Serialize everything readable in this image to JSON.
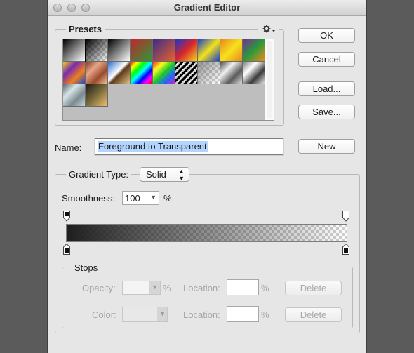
{
  "window": {
    "title": "Gradient Editor"
  },
  "presets": {
    "label": "Presets",
    "menu_icon": "gear-icon",
    "swatches": [
      {
        "name": "foreground-to-background"
      },
      {
        "name": "foreground-to-transparent"
      },
      {
        "name": "black-white"
      },
      {
        "name": "red-green"
      },
      {
        "name": "violet-orange"
      },
      {
        "name": "blue-red-yellow"
      },
      {
        "name": "blue-yellow-blue"
      },
      {
        "name": "orange-yellow-orange"
      },
      {
        "name": "violet-green-orange"
      },
      {
        "name": "yellow-violet-orange-blue"
      },
      {
        "name": "copper"
      },
      {
        "name": "chrome"
      },
      {
        "name": "spectrum"
      },
      {
        "name": "transparent-rainbow"
      },
      {
        "name": "transparent-stripes"
      },
      {
        "name": "neutral-density"
      },
      {
        "name": "silver-1"
      },
      {
        "name": "silver-2"
      },
      {
        "name": "silver-3"
      },
      {
        "name": "gold"
      }
    ]
  },
  "buttons": {
    "ok": "OK",
    "cancel": "Cancel",
    "load": "Load...",
    "save": "Save...",
    "new": "New"
  },
  "name": {
    "label": "Name:",
    "value": "Foreground to Transparent"
  },
  "gradient_type": {
    "label": "Gradient Type:",
    "value": "Solid"
  },
  "smoothness": {
    "label": "Smoothness:",
    "value": "100",
    "unit": "%"
  },
  "gradient_bar": {
    "start_color": "#1e1e1e",
    "end_color": "transparent",
    "checker_color": "#cfcfcf"
  },
  "stops": {
    "label": "Stops",
    "opacity_label": "Opacity:",
    "opacity_unit": "%",
    "color_label": "Color:",
    "location_label": "Location:",
    "location_unit": "%",
    "delete_label": "Delete"
  }
}
